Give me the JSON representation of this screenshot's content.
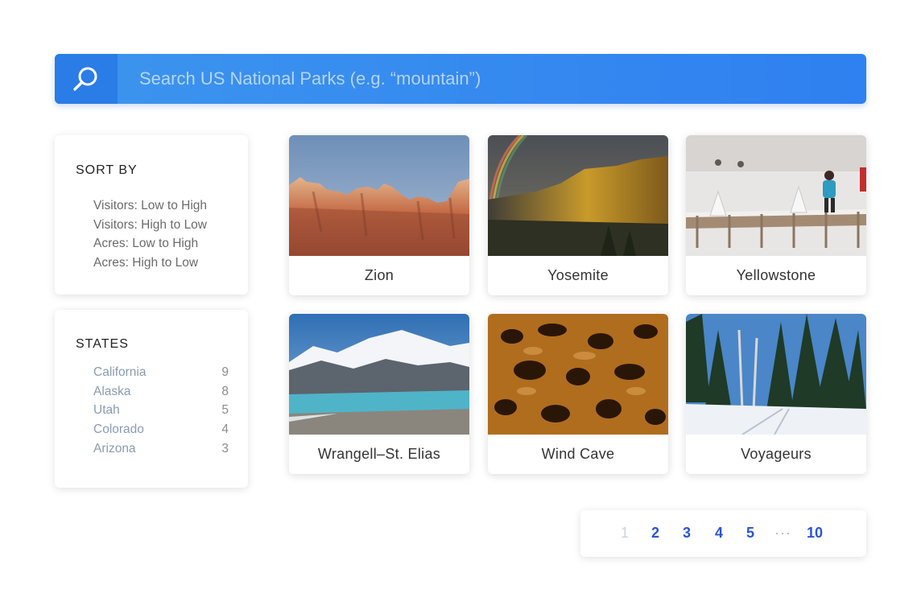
{
  "search": {
    "placeholder": "Search US National Parks (e.g. “mountain”)",
    "icon": "search-icon",
    "colors": {
      "bar": "#3d95ee",
      "button": "#2a7ce6"
    }
  },
  "sort": {
    "title": "SORT BY",
    "options": [
      "Visitors: Low to High",
      "Visitors: High to Low",
      "Acres: Low to High",
      "Acres: High to Low"
    ]
  },
  "states": {
    "title": "STATES",
    "items": [
      {
        "name": "California",
        "count": "9"
      },
      {
        "name": "Alaska",
        "count": "8"
      },
      {
        "name": "Utah",
        "count": "5"
      },
      {
        "name": "Colorado",
        "count": "4"
      },
      {
        "name": "Arizona",
        "count": "3"
      }
    ]
  },
  "parks": [
    {
      "name": "Zion"
    },
    {
      "name": "Yosemite"
    },
    {
      "name": "Yellowstone"
    },
    {
      "name": "Wrangell–St. Elias"
    },
    {
      "name": "Wind Cave"
    },
    {
      "name": "Voyageurs"
    }
  ],
  "pagination": {
    "pages": [
      "1",
      "2",
      "3",
      "4",
      "5",
      "10"
    ],
    "ellipsis": "···",
    "current": "1",
    "colors": {
      "active_link": "#2a54d6",
      "current": "#c9d3e0"
    }
  }
}
